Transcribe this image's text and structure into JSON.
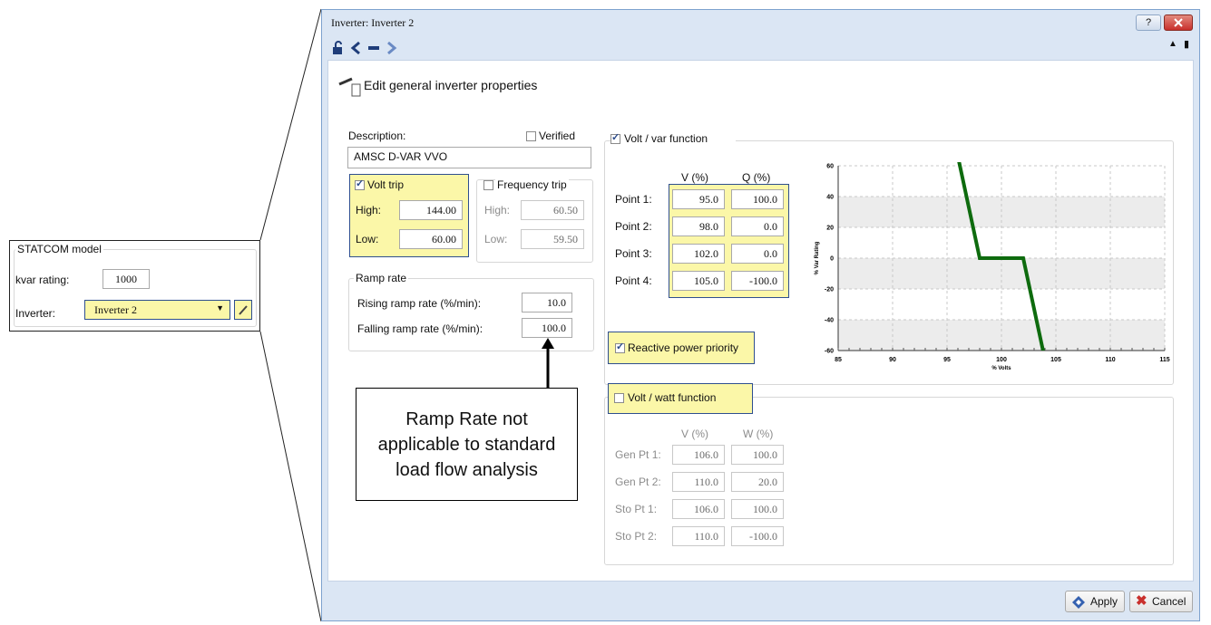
{
  "statcom": {
    "title": "STATCOM model",
    "kvar_label": "kvar rating:",
    "kvar_value": "1000",
    "inverter_label": "Inverter:",
    "inverter_value": "Inverter 2"
  },
  "dialog": {
    "title": "Inverter: Inverter 2",
    "help_button": "?",
    "heading": "Edit general inverter properties",
    "description_label": "Description:",
    "verified_label": "Verified",
    "description_value": "AMSC D-VAR VVO",
    "volt_trip": {
      "label": "Volt trip",
      "high_label": "High:",
      "high_value": "144.00",
      "low_label": "Low:",
      "low_value": "60.00"
    },
    "freq_trip": {
      "label": "Frequency trip",
      "high_label": "High:",
      "high_value": "60.50",
      "low_label": "Low:",
      "low_value": "59.50"
    },
    "ramp": {
      "label": "Ramp rate",
      "rising_label": "Rising ramp rate (%/min):",
      "rising_value": "10.0",
      "falling_label": "Falling ramp rate (%/min):",
      "falling_value": "100.0"
    },
    "voltvar": {
      "label": "Volt / var function",
      "col_v": "V (%)",
      "col_q": "Q (%)",
      "points": [
        {
          "label": "Point 1:",
          "v": "95.0",
          "q": "100.0"
        },
        {
          "label": "Point 2:",
          "v": "98.0",
          "q": "0.0"
        },
        {
          "label": "Point 3:",
          "v": "102.0",
          "q": "0.0"
        },
        {
          "label": "Point 4:",
          "v": "105.0",
          "q": "-100.0"
        }
      ],
      "reactive_priority_label": "Reactive power priority"
    },
    "voltwatt": {
      "label": "Volt / watt function",
      "col_v": "V (%)",
      "col_w": "W (%)",
      "points": [
        {
          "label": "Gen Pt 1:",
          "v": "106.0",
          "w": "100.0"
        },
        {
          "label": "Gen Pt 2:",
          "v": "110.0",
          "w": "20.0"
        },
        {
          "label": "Sto Pt 1:",
          "v": "106.0",
          "w": "100.0"
        },
        {
          "label": "Sto Pt 2:",
          "v": "110.0",
          "w": "-100.0"
        }
      ]
    },
    "apply_label": "Apply",
    "cancel_label": "Cancel"
  },
  "callout": {
    "text": "Ramp Rate not applicable to standard load flow analysis"
  },
  "chart_data": {
    "type": "line",
    "xlabel": "% Volts",
    "ylabel": "% Var Rating",
    "xlim": [
      85,
      115
    ],
    "ylim": [
      -60,
      60
    ],
    "xticks": [
      85,
      90,
      95,
      100,
      105,
      110,
      115
    ],
    "yticks": [
      -60,
      -40,
      -20,
      0,
      20,
      40,
      60
    ],
    "grid": true,
    "series": [
      {
        "x": [
          96,
          98,
          102,
          104
        ],
        "y": [
          66,
          0,
          0,
          -66
        ],
        "color": "#0e6b0e"
      }
    ]
  },
  "colors": {
    "highlight": "#fbf7a8",
    "highlight_border": "#2f4f8f",
    "curve": "#0e6b0e",
    "close": "#c9302c"
  },
  "icons": {
    "lock": "lock-open-icon",
    "back": "chevron-left-icon",
    "minus": "dash-icon",
    "forward": "chevron-right-icon",
    "edit": "edit-document-icon"
  }
}
